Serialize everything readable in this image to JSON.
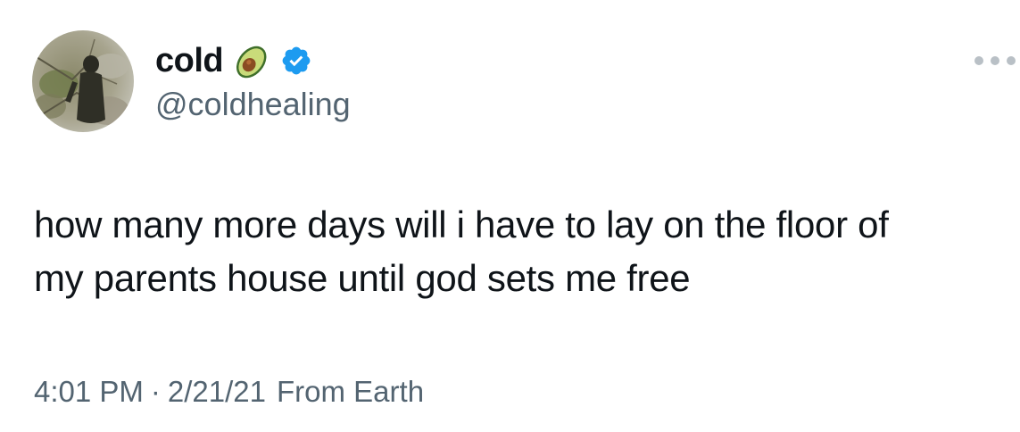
{
  "author": {
    "display_name": "cold",
    "handle": "@coldhealing",
    "verified": true,
    "emoji_icon": "avocado-icon",
    "avatar_icon": "profile-photo"
  },
  "tweet": {
    "text": "how many more days will i have to lay on the floor of\nmy parents house until god sets me free",
    "time": "4:01 PM",
    "separator": "·",
    "date": "2/21/21",
    "source": "From Earth"
  },
  "actions": {
    "more_icon": "more-options-icon"
  },
  "colors": {
    "text_primary": "#0f1419",
    "text_secondary": "#536471",
    "verified_blue": "#1d9bf0",
    "more_dots": "#b9c0c6",
    "background": "#ffffff"
  }
}
